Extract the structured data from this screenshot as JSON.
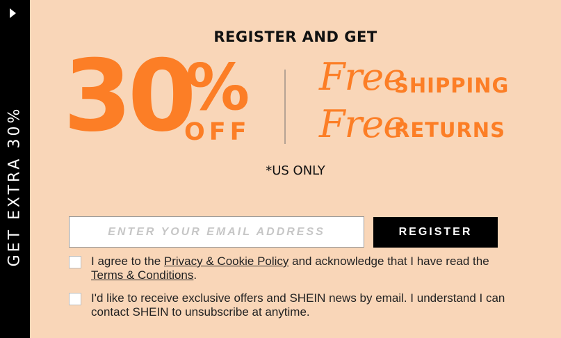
{
  "side_tab": {
    "text": "GET EXTRA 30%",
    "arrow_icon": "caret-right-icon"
  },
  "hero": {
    "headline": "REGISTER AND GET",
    "big_number": "30",
    "percent_sign": "%",
    "off": "OFF",
    "perks": [
      {
        "script": "Free",
        "label": "SHIPPING"
      },
      {
        "script": "Free",
        "label": "RETURNS"
      }
    ],
    "note": "*US ONLY"
  },
  "form": {
    "email_placeholder": "ENTER YOUR EMAIL ADDRESS",
    "email_value": "",
    "register_label": "REGISTER"
  },
  "consents": [
    {
      "text_1": "I agree to the ",
      "link_1": "Privacy & Cookie Policy",
      "text_2": " and acknowledge that I have read the ",
      "link_2": "Terms & Conditions",
      "text_3": ".",
      "checked": false
    },
    {
      "text": "I'd like to receive exclusive offers and SHEIN news by email. I understand I can contact SHEIN to unsubscribe at anytime.",
      "checked": false
    }
  ],
  "colors": {
    "background": "#f9d6b8",
    "accent": "#fc7e26",
    "dark": "#000000"
  }
}
